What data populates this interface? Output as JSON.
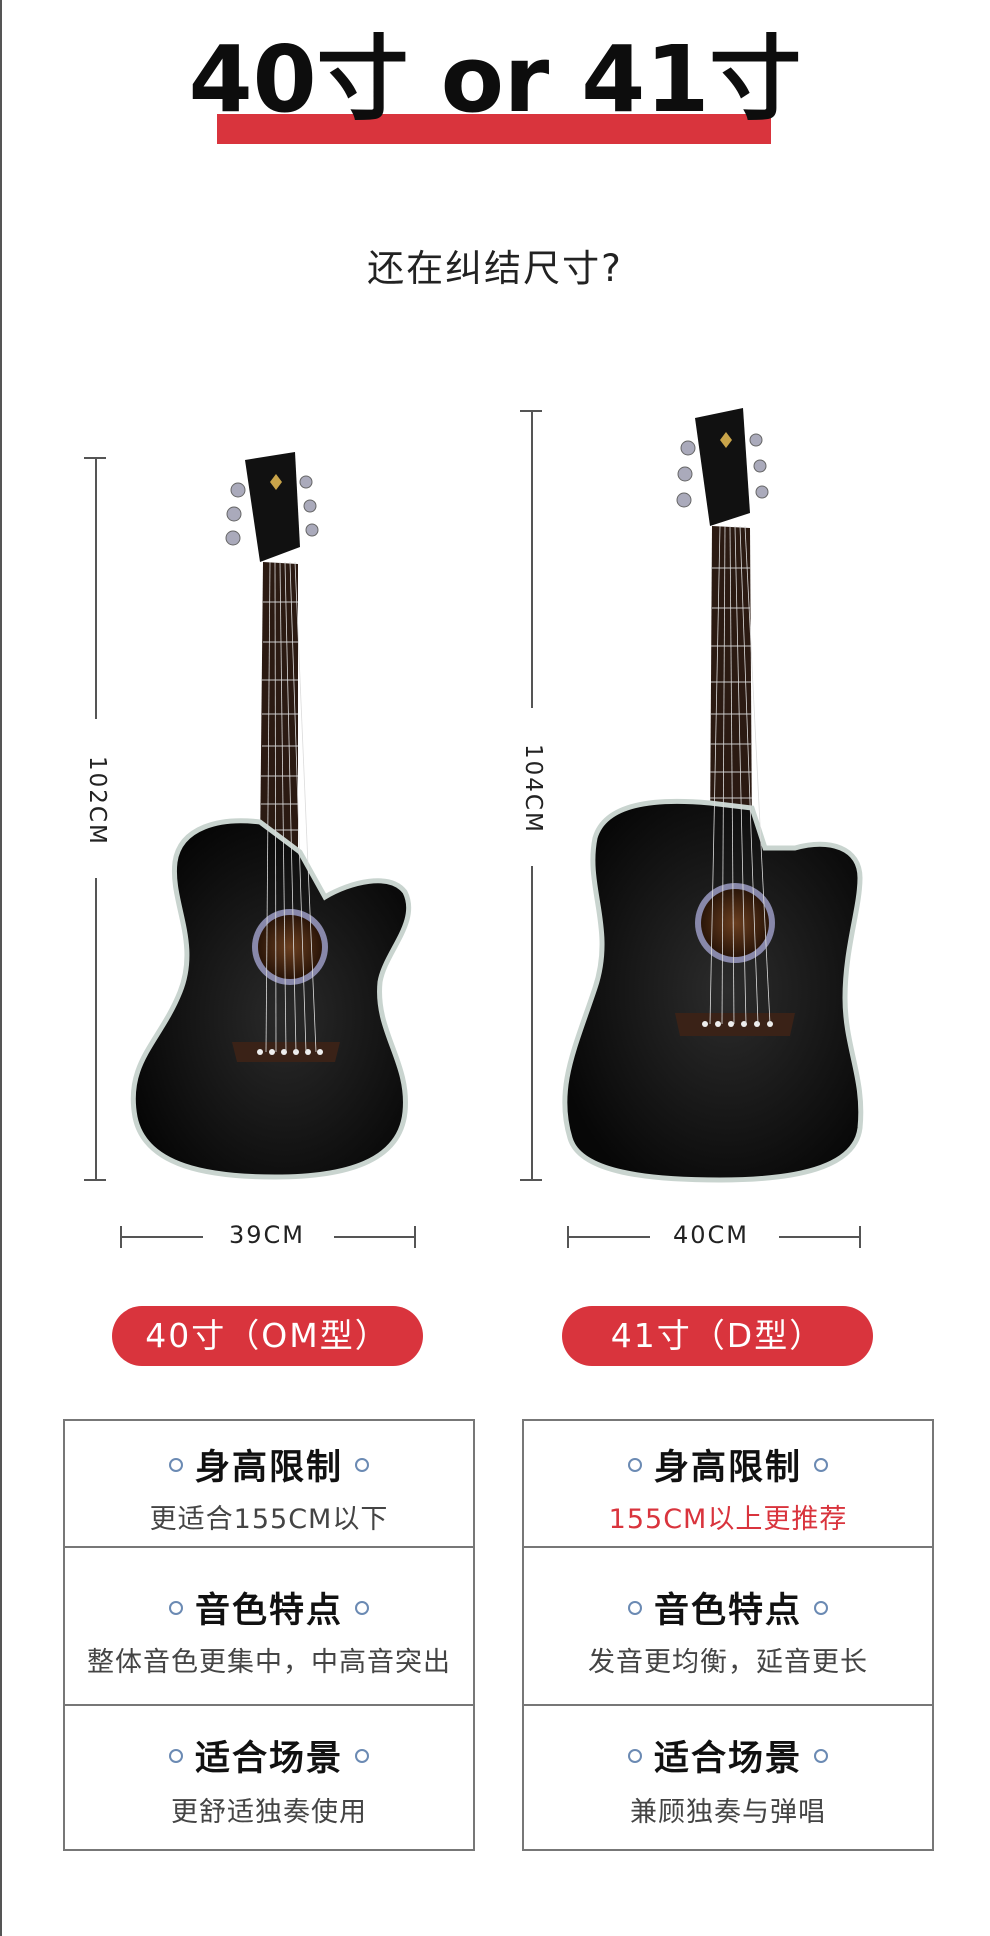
{
  "header": {
    "title": "40寸 or 41寸",
    "subtitle": "还在纠结尺寸?"
  },
  "left": {
    "height_label": "102CM",
    "width_label": "39CM",
    "model": "40寸（OM型）",
    "specs": [
      {
        "title": "身高限制",
        "value": "更适合155CM以下"
      },
      {
        "title": "音色特点",
        "value": "整体音色更集中，中高音突出"
      },
      {
        "title": "适合场景",
        "value": "更舒适独奏使用"
      }
    ]
  },
  "right": {
    "height_label": "104CM",
    "width_label": "40CM",
    "model": "41寸（D型）",
    "specs": [
      {
        "title": "身高限制",
        "value": "155CM以上更推荐"
      },
      {
        "title": "音色特点",
        "value": "发音更均衡，延音更长"
      },
      {
        "title": "适合场景",
        "value": "兼顾独奏与弹唱"
      }
    ]
  },
  "colors": {
    "accent_red": "#d9343d",
    "guitar_body": "#0c0c0c",
    "binding": "#c9d4cf",
    "line": "#555555"
  },
  "icons": [
    "guitar-om-image",
    "guitar-d-image",
    "circle-bullet-icon"
  ]
}
